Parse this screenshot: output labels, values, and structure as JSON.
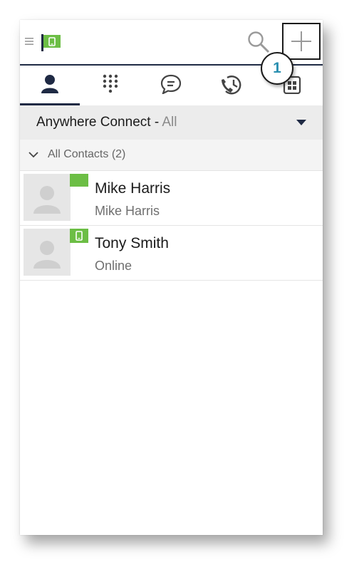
{
  "callout": {
    "number": "1"
  },
  "filter": {
    "label": "Anywhere Connect - ",
    "value": "All"
  },
  "group": {
    "label": "All Contacts (2)"
  },
  "contacts": [
    {
      "name": "Mike Harris",
      "subtitle": "Mike Harris",
      "presence": "available-flag-icon"
    },
    {
      "name": "Tony Smith",
      "subtitle": "Online",
      "presence": "mobile-online-icon"
    }
  ],
  "tabs": [
    {
      "icon": "contacts-icon",
      "active": true
    },
    {
      "icon": "dialpad-icon",
      "active": false
    },
    {
      "icon": "chat-icon",
      "active": false
    },
    {
      "icon": "call-history-icon",
      "active": false
    },
    {
      "icon": "apps-icon",
      "active": false
    }
  ],
  "colors": {
    "accent": "#1f2a44",
    "presence_green": "#6cbe45",
    "callout_text": "#2a8fb0"
  }
}
